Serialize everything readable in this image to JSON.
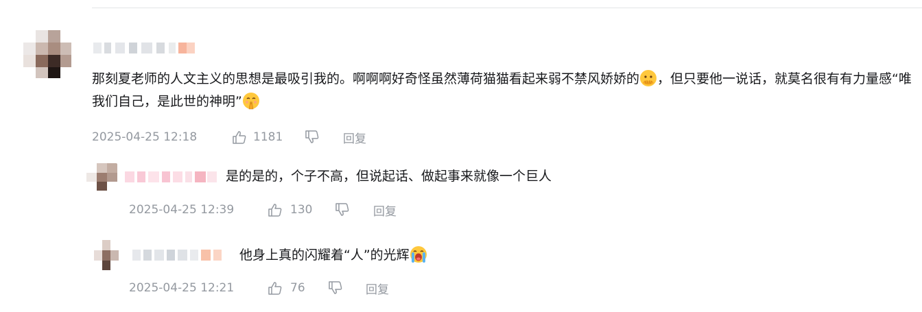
{
  "comments": [
    {
      "text_1": "那刻夏老师的人文主义的思想是最吸引我的。啊啊啊好奇怪虽然薄荷猫猫看起来弱不禁风娇娇的",
      "text_2": "，但只要他一说话，就莫名很有有力量感“唯我们自己，是此世的神明”",
      "time": "2025-04-25 12:18",
      "likes": "1181",
      "reply_label": "回复",
      "emoji_1": "face-with-hands-over-mouth-emoji",
      "emoji_2": "praying-face-emoji"
    }
  ],
  "replies": [
    {
      "text": "是的是的，个子不高，但说起话、做起事来就像一个巨人",
      "time": "2025-04-25 12:39",
      "likes": "130",
      "reply_label": "回复"
    },
    {
      "text": "他身上真的闪耀着“人”的光辉",
      "time": "2025-04-25 12:21",
      "likes": "76",
      "reply_label": "回复",
      "emoji": "crying-face-emoji"
    }
  ],
  "icons": {
    "like": "thumbs-up-icon",
    "dislike": "thumbs-down-icon"
  },
  "colors": {
    "text": "#18191c",
    "meta": "#9499a0",
    "divider": "#e3e5e7"
  }
}
